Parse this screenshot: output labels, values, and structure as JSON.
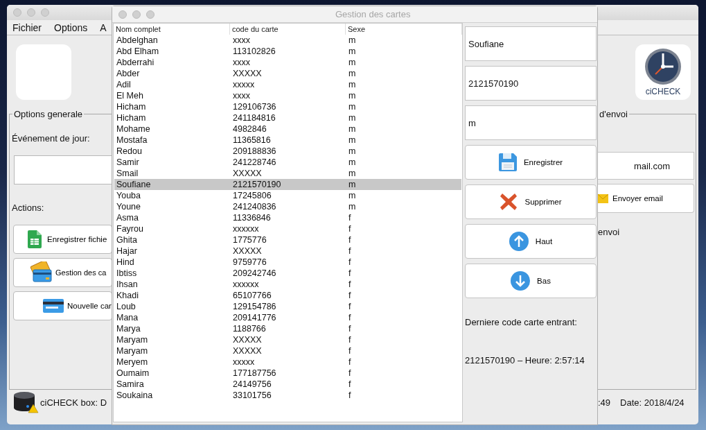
{
  "main_window": {
    "menu": [
      "Fichier",
      "Options",
      "A"
    ],
    "options_general": {
      "legend": "Options generale",
      "event_label": "Événement de jour:",
      "actions_label": "Actions:",
      "buttons": [
        {
          "label": "Enregistrer fichie",
          "kind": "sheet"
        },
        {
          "label": "Gestion des ca",
          "kind": "cards"
        },
        {
          "label": "Nouvelle car",
          "kind": "card"
        }
      ]
    },
    "status_left": "ciCHECK box: D",
    "logo_text": "ciCHECK",
    "send_options": {
      "legend": "d'envoi",
      "email": "mail.com",
      "send_button": "Envoyer email",
      "label": "envoi"
    },
    "status_time": ":49",
    "status_date": "Date: 2018/4/24"
  },
  "dialog": {
    "title": "Gestion des cartes",
    "table": {
      "columns": [
        "Nom complet",
        "code du carte",
        "Sexe"
      ],
      "rows": [
        {
          "name": "Abdelghan",
          "code": "xxxx",
          "sexe": "m",
          "selected": false
        },
        {
          "name": "Abd Elham",
          "code": "113102826",
          "sexe": "m",
          "selected": false
        },
        {
          "name": "Abderrahi",
          "code": "xxxx",
          "sexe": "m",
          "selected": false
        },
        {
          "name": "Abder",
          "code": "XXXXX",
          "sexe": "m",
          "selected": false
        },
        {
          "name": "Adil",
          "code": "xxxxx",
          "sexe": "m",
          "selected": false
        },
        {
          "name": "El Meh",
          "code": "xxxx",
          "sexe": "m",
          "selected": false
        },
        {
          "name": "Hicham",
          "code": "129106736",
          "sexe": "m",
          "selected": false
        },
        {
          "name": "Hicham",
          "code": "241184816",
          "sexe": "m",
          "selected": false
        },
        {
          "name": "Mohame",
          "code": "4982846",
          "sexe": "m",
          "selected": false
        },
        {
          "name": "Mostafa",
          "code": "11365816",
          "sexe": "m",
          "selected": false
        },
        {
          "name": "Redou",
          "code": "209188836",
          "sexe": "m",
          "selected": false
        },
        {
          "name": "Samir",
          "code": "241228746",
          "sexe": "m",
          "selected": false
        },
        {
          "name": "Smail",
          "code": "XXXXX",
          "sexe": "m",
          "selected": false
        },
        {
          "name": "Soufiane",
          "code": "2121570190",
          "sexe": "m",
          "selected": true
        },
        {
          "name": "Youba",
          "code": "17245806",
          "sexe": "m",
          "selected": false
        },
        {
          "name": "Youne",
          "code": "241240836",
          "sexe": "m",
          "selected": false
        },
        {
          "name": "Asma",
          "code": "11336846",
          "sexe": "f",
          "selected": false
        },
        {
          "name": "Fayrou",
          "code": "xxxxxx",
          "sexe": "f",
          "selected": false
        },
        {
          "name": "Ghita",
          "code": "1775776",
          "sexe": "f",
          "selected": false
        },
        {
          "name": "Hajar",
          "code": "XXXXX",
          "sexe": "f",
          "selected": false
        },
        {
          "name": "Hind",
          "code": "9759776",
          "sexe": "f",
          "selected": false
        },
        {
          "name": "Ibtiss",
          "code": "209242746",
          "sexe": "f",
          "selected": false
        },
        {
          "name": "Ihsan",
          "code": "xxxxxx",
          "sexe": "f",
          "selected": false
        },
        {
          "name": "Khadi",
          "code": "65107766",
          "sexe": "f",
          "selected": false
        },
        {
          "name": "Loub",
          "code": "129154786",
          "sexe": "f",
          "selected": false
        },
        {
          "name": "Mana",
          "code": "209141776",
          "sexe": "f",
          "selected": false
        },
        {
          "name": "Marya",
          "code": "1188766",
          "sexe": "f",
          "selected": false
        },
        {
          "name": "Maryam",
          "code": "XXXXX",
          "sexe": "f",
          "selected": false
        },
        {
          "name": "Maryam",
          "code": "XXXXX",
          "sexe": "f",
          "selected": false
        },
        {
          "name": "Meryem",
          "code": "xxxxx",
          "sexe": "f",
          "selected": false
        },
        {
          "name": "Oumaim",
          "code": "177187756",
          "sexe": "f",
          "selected": false
        },
        {
          "name": "Samira",
          "code": "24149756",
          "sexe": "f",
          "selected": false
        },
        {
          "name": "Soukaina",
          "code": "33101756",
          "sexe": "f",
          "selected": false
        }
      ]
    },
    "fields": [
      "Soufiane",
      "2121570190",
      "m"
    ],
    "buttons": [
      {
        "label": "Enregistrer",
        "kind": "save"
      },
      {
        "label": "Supprimer",
        "kind": "delete"
      },
      {
        "label": "Haut",
        "kind": "up"
      },
      {
        "label": "Bas",
        "kind": "down"
      }
    ],
    "last_label": "Derniere code carte entrant:",
    "last_value": "2121570190 – Heure: 2:57:14"
  }
}
